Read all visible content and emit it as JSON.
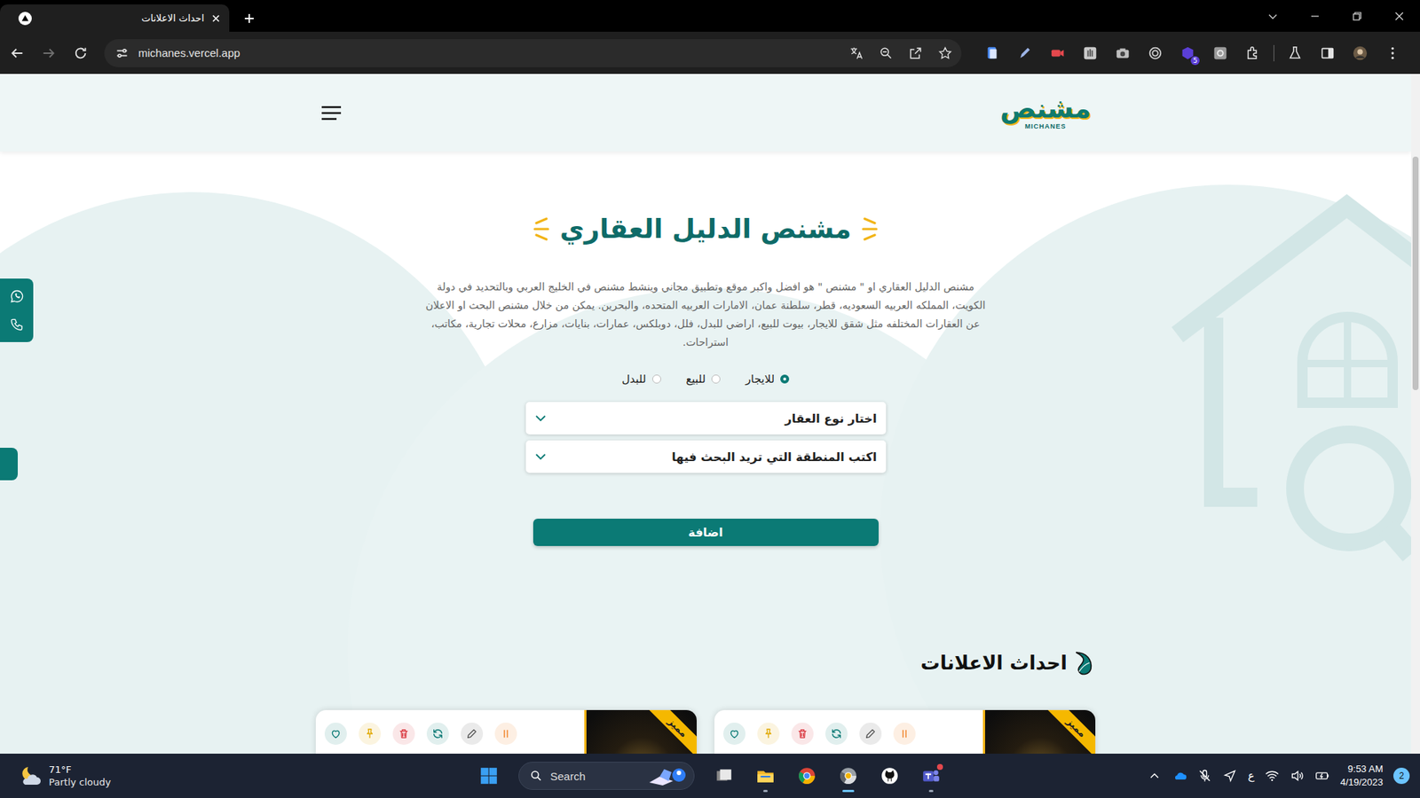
{
  "browser": {
    "tabs": [
      {
        "title": "احداث الاعلانات",
        "selected": true
      }
    ],
    "navigation": {
      "back_enabled": true,
      "forward_enabled": false
    },
    "address": "michanes.vercel.app",
    "bookmarked": false,
    "extension_badge": "5"
  },
  "site": {
    "logo": {
      "mark": "مشنص",
      "wordmark": "MICHANES"
    },
    "hero": {
      "title": "مشنص الدليل العقاري",
      "description": "مشنص الدليل العقاري او \" مشنص \" هو افضل واكبر موقع وتطبيق مجاني وينشط مشنص في الخليج العربي وبالتحديد في دولة الكويت، المملكه العربيه السعوديه، قطر، سلطنة عمان، الامارات العربيه المتحده، والبحرين. يمكن من خلال مشنص البحث او الاعلان عن العقارات المختلفه مثل شقق للايجار، بيوت للبيع، اراضي للبدل، فلل، دوبلكس، عمارات، بنايات، مزارع، محلات تجارية، مكاتب، استراحات."
    },
    "listing_types": [
      {
        "label": "للايجار",
        "selected": true
      },
      {
        "label": "للبيع",
        "selected": false
      },
      {
        "label": "للبدل",
        "selected": false
      }
    ],
    "property_type": {
      "placeholder": "اختار نوع العقار"
    },
    "area": {
      "placeholder": "اكتب المنطقة التي تريد البحث فيها"
    },
    "submit": "اضافة",
    "ads_section": {
      "title": "احداث الاعلانات",
      "actions": [
        {
          "kind": "favorite",
          "color": "#0b7a75"
        },
        {
          "kind": "pin",
          "color": "#e0a800"
        },
        {
          "kind": "delete",
          "color": "#d9363e"
        },
        {
          "kind": "renew",
          "color": "#0b7a75"
        },
        {
          "kind": "edit",
          "color": "#555555"
        },
        {
          "kind": "pause",
          "color": "#f07a1a"
        }
      ],
      "ads": [
        {
          "badge": "مميز"
        },
        {
          "badge": "مميز"
        }
      ]
    }
  },
  "taskbar": {
    "weather": {
      "temperature": "71°F",
      "condition": "Partly cloudy"
    },
    "search": {
      "placeholder": "Search"
    },
    "apps": [
      {
        "kind": "task-view",
        "running": false,
        "active": false,
        "notified": false
      },
      {
        "kind": "file-explorer",
        "running": true,
        "active": false,
        "notified": false
      },
      {
        "kind": "chrome",
        "running": false,
        "active": false,
        "notified": false
      },
      {
        "kind": "chrome-dev",
        "running": true,
        "active": true,
        "notified": false
      },
      {
        "kind": "github",
        "running": false,
        "active": false,
        "notified": false
      },
      {
        "kind": "teams",
        "running": true,
        "active": false,
        "notified": true
      }
    ],
    "microphone": {
      "muted": true
    },
    "input_language": "ع",
    "time": "9:53 AM",
    "date": "4/19/2023",
    "notifications": "2"
  }
}
